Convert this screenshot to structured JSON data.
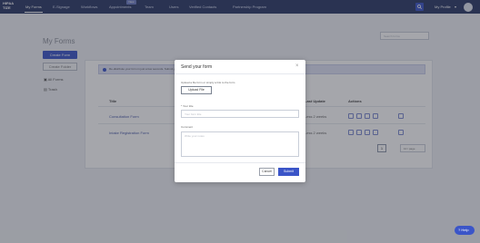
{
  "topnav": {
    "logo_line1": "HIPAA",
    "logo_line2": "TIZE",
    "items": [
      "My Forms",
      "E-Signage",
      "Workflows",
      "Appointments",
      "Team",
      "Users",
      "Verified Contacts",
      "Partnership Program"
    ],
    "active_item": "My Forms",
    "new_badge": "New",
    "profile_label": "My Profile",
    "profile_caret": "▾"
  },
  "page": {
    "title": "My Forms",
    "search_placeholder": "Search forms",
    "create_button": "Create Form",
    "create_folder_button": "Create Folder",
    "side_links": [
      "All Forms",
      "Trash"
    ]
  },
  "panel": {
    "banner_text": "Re-distribute your form in just a few seconds. Submit your own forms to get started.",
    "columns": [
      "Title",
      "Last Update",
      "Actions"
    ],
    "rows": [
      {
        "title": "Consultation Form",
        "updated": "Less 2 weeks"
      },
      {
        "title": "Intake Registration Form",
        "updated": "Less 2 weeks"
      }
    ],
    "page_number": "1",
    "per_page": "10 / page"
  },
  "modal": {
    "title": "Send your form",
    "close": "×",
    "instruction": "Upload a file form or simply a link to the form",
    "upload_button": "Upload File",
    "email_label": "* Your title",
    "email_placeholder": "Your form title",
    "comment_label": "Comment",
    "comment_placeholder": "Write your notes",
    "cancel_button": "Cancel",
    "submit_button": "Submit"
  },
  "help": {
    "label": "Help"
  },
  "colors": {
    "nav": "#2b3a67",
    "accent": "#3b55c8"
  },
  "icons": {
    "search": "search-icon",
    "help": "help-icon",
    "close": "close-icon"
  }
}
